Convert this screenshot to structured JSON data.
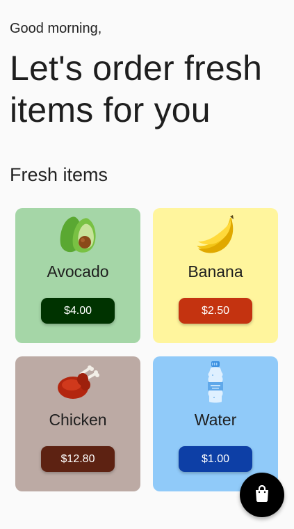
{
  "header": {
    "greeting": "Good morning,",
    "headline": "Let's order fresh items for you"
  },
  "section": {
    "title": "Fresh items"
  },
  "items": [
    {
      "name": "Avocado",
      "price": "$4.00",
      "icon": "avocado-icon",
      "card_color": "#a5d6a7",
      "button_color": "#003300"
    },
    {
      "name": "Banana",
      "price": "$2.50",
      "icon": "banana-icon",
      "card_color": "#fff59d",
      "button_color": "#c43310"
    },
    {
      "name": "Chicken",
      "price": "$12.80",
      "icon": "chicken-icon",
      "card_color": "#bcaaa4",
      "button_color": "#5d2212"
    },
    {
      "name": "Water",
      "price": "$1.00",
      "icon": "water-bottle-icon",
      "card_color": "#90caf9",
      "button_color": "#0d3fa6"
    }
  ],
  "fab": {
    "icon": "shopping-bag-icon",
    "color": "#000000"
  }
}
